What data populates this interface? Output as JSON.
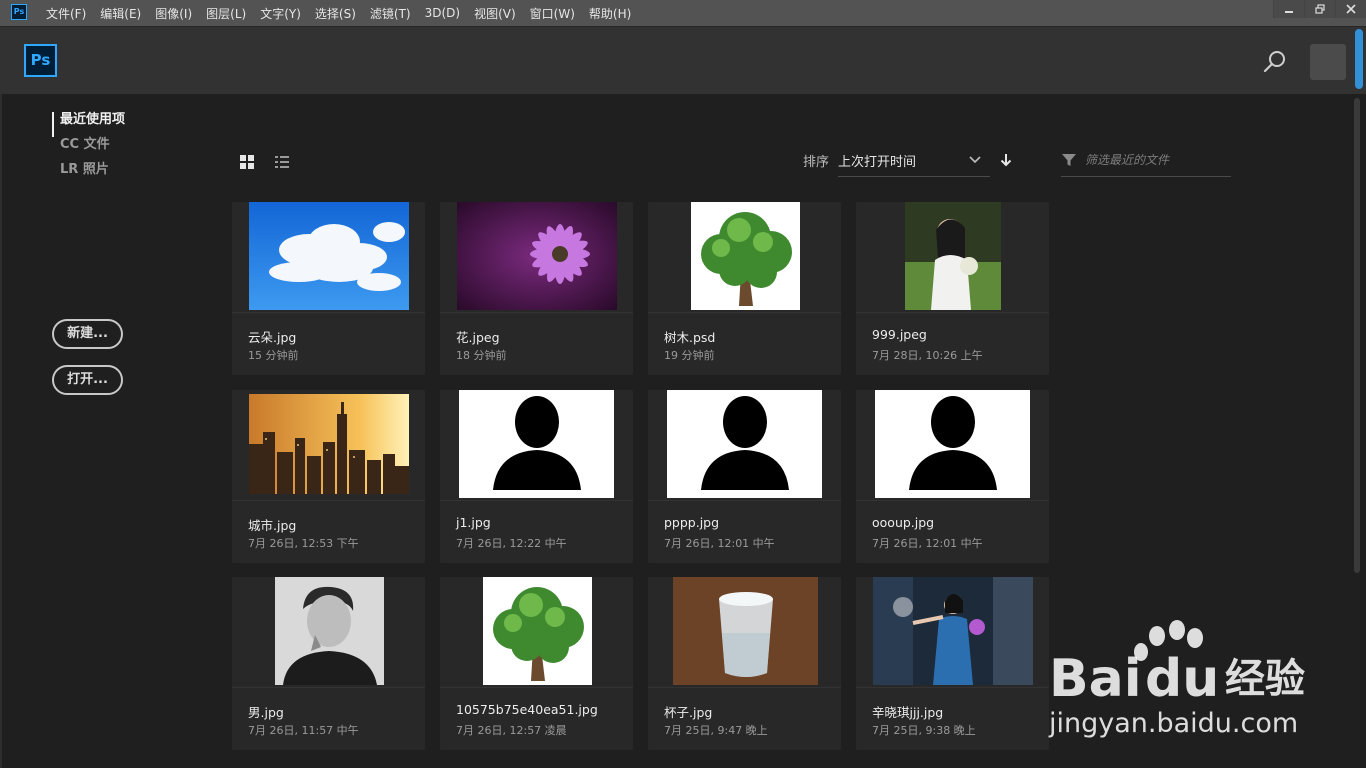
{
  "app": {
    "icon_label": "Ps",
    "logo_label": "Ps"
  },
  "menu": [
    "文件(F)",
    "编辑(E)",
    "图像(I)",
    "图层(L)",
    "文字(Y)",
    "选择(S)",
    "滤镜(T)",
    "3D(D)",
    "视图(V)",
    "窗口(W)",
    "帮助(H)"
  ],
  "nav": {
    "recent": "最近使用项",
    "cc_files": "CC 文件",
    "lr_photos": "LR 照片"
  },
  "buttons": {
    "new": "新建...",
    "open": "打开..."
  },
  "sort": {
    "label": "排序",
    "value": "上次打开时间"
  },
  "filter": {
    "placeholder": "筛选最近的文件"
  },
  "files": [
    {
      "name": "云朵.jpg",
      "time": "15 分钟前",
      "thumb": "clouds"
    },
    {
      "name": "花.jpeg",
      "time": "18 分钟前",
      "thumb": "flower"
    },
    {
      "name": "树木.psd",
      "time": "19 分钟前",
      "thumb": "tree"
    },
    {
      "name": "999.jpeg",
      "time": "7月 28日, 10:26 上午",
      "thumb": "girl"
    },
    {
      "name": "城市.jpg",
      "time": "7月 26日, 12:53 下午",
      "thumb": "city"
    },
    {
      "name": "j1.jpg",
      "time": "7月 26日, 12:22 中午",
      "thumb": "silhouette"
    },
    {
      "name": "pppp.jpg",
      "time": "7月 26日, 12:01 中午",
      "thumb": "silhouette"
    },
    {
      "name": "oooup.jpg",
      "time": "7月 26日, 12:01 中午",
      "thumb": "silhouette"
    },
    {
      "name": "男.jpg",
      "time": "7月 26日, 11:57 中午",
      "thumb": "man"
    },
    {
      "name": "10575b75e40ea51.jpg",
      "time": "7月 26日, 12:57 凌晨",
      "thumb": "tree"
    },
    {
      "name": "杯子.jpg",
      "time": "7月 25日, 9:47 晚上",
      "thumb": "cup"
    },
    {
      "name": "辛晓琪jjj.jpg",
      "time": "7月 25日, 9:38 晚上",
      "thumb": "stage"
    }
  ],
  "watermark": {
    "brand": "Bai",
    "brand_end": "du",
    "brand_cn": "经验",
    "url": "jingyan.baidu.com"
  },
  "colors": {
    "accent": "#31a8ff",
    "background": "#1e1e1e",
    "card": "#282828"
  }
}
